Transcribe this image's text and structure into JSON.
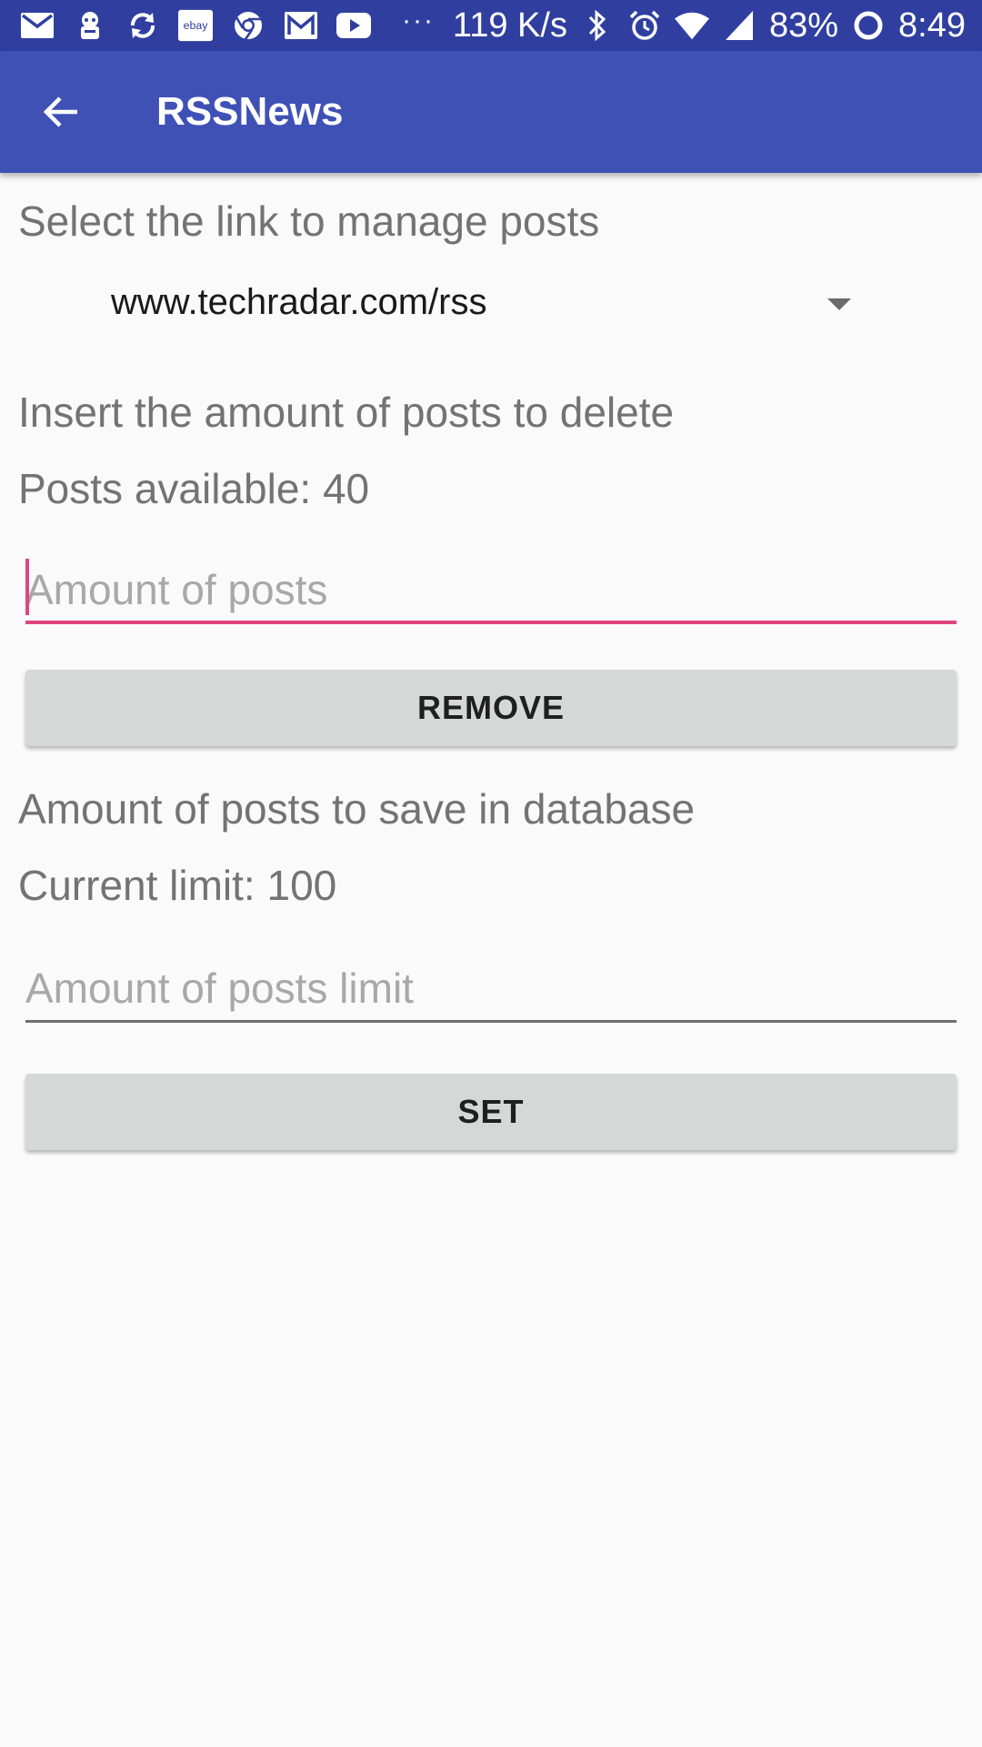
{
  "status_bar": {
    "icons": [
      "mail-icon",
      "ghost-icon",
      "sync-icon",
      "ebay-icon",
      "chrome-icon",
      "gmail-icon",
      "youtube-icon"
    ],
    "ebay_text": "ebay",
    "more": "···",
    "network_speed": "119 K/s",
    "battery": "83%",
    "time": "8:49"
  },
  "app_bar": {
    "title": "RSSNews"
  },
  "manage": {
    "heading": "Select the link to manage posts",
    "selected_link": "www.techradar.com/rss"
  },
  "delete": {
    "heading": "Insert the amount of posts to delete",
    "available_label": "Posts available: 40",
    "input_placeholder": "Amount of posts",
    "button_label": "REMOVE"
  },
  "limit": {
    "heading": "Amount of posts to save in database",
    "current_label": "Current limit: 100",
    "input_placeholder": "Amount of posts limit",
    "button_label": "SET"
  },
  "colors": {
    "status_bar": "#303f9f",
    "app_bar": "#3f51b5",
    "accent": "#e0457e",
    "background": "#fafafa",
    "button": "#d6d7d7"
  }
}
